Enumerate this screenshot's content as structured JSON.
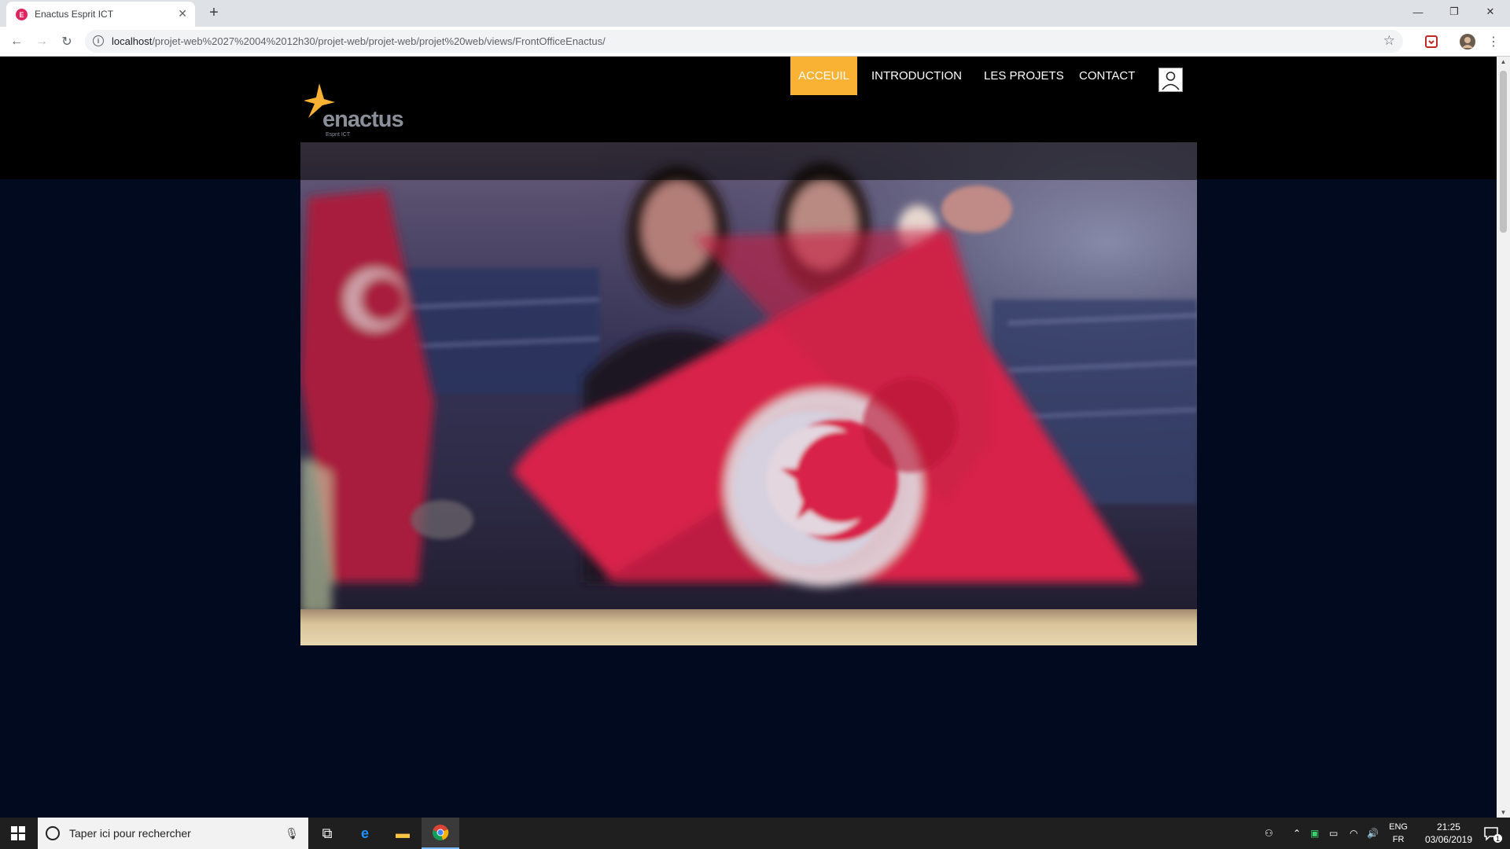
{
  "browser": {
    "tab_title": "Enactus Esprit ICT",
    "tab_favicon_letter": "E",
    "url_host": "localhost",
    "url_path": "/projet-web%2027%2004%2012h30/projet-web/projet-web/projet%20web/views/FrontOfficeEnactus/"
  },
  "site": {
    "logo_word": "enactus",
    "logo_sub": "Esprit ICT",
    "accent_color": "#f9b233",
    "nav": [
      {
        "label": "ACCEUIL",
        "active": true
      },
      {
        "label": "INTRODUCTION",
        "active": false
      },
      {
        "label": "LES PROJETS",
        "active": false
      },
      {
        "label": "CONTACT",
        "active": false
      }
    ]
  },
  "taskbar": {
    "search_placeholder": "Taper ici pour rechercher",
    "lang_top": "ENG",
    "lang_bottom": "FR",
    "time": "21:25",
    "date": "03/06/2019",
    "notification_count": "1"
  }
}
